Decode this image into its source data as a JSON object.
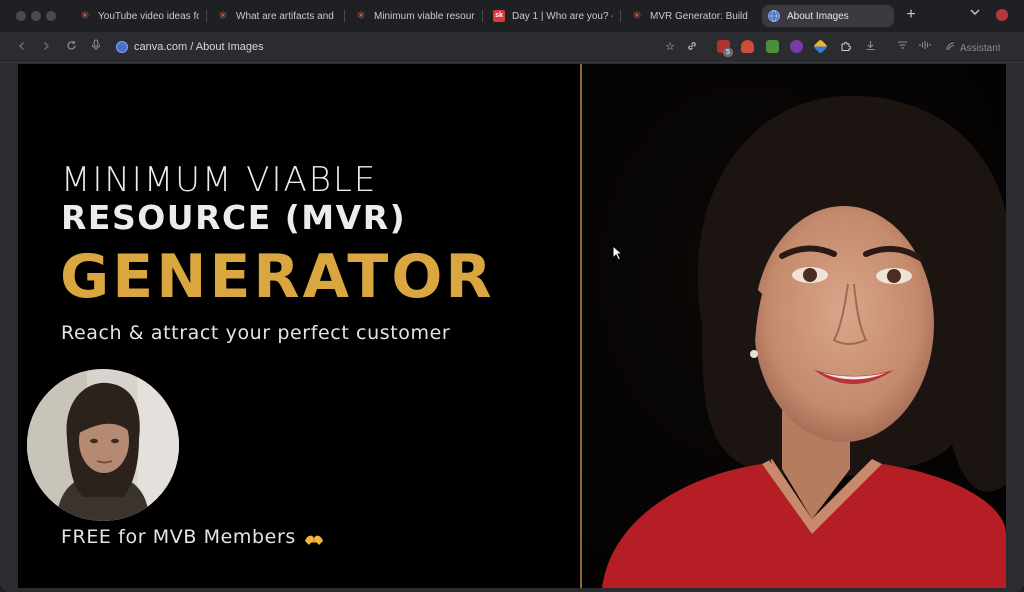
{
  "browser": {
    "tabs": [
      {
        "title": "YouTube video ideas for",
        "icon": "canva-asterisk-icon",
        "active": false
      },
      {
        "title": "What are artifacts and",
        "icon": "canva-asterisk-icon",
        "active": false
      },
      {
        "title": "Minimum viable resourc",
        "icon": "canva-asterisk-icon",
        "active": false
      },
      {
        "title": "Day 1 | Who are you? -",
        "icon": "sk-icon",
        "active": false
      },
      {
        "title": "MVR Generator: Build L",
        "icon": "canva-asterisk-icon",
        "active": false
      },
      {
        "title": "About Images",
        "icon": "globe-icon",
        "active": true
      }
    ],
    "address": "canva.com / About Images",
    "assistant_label": "Assistant",
    "extension_badge": "5",
    "sk_icon_label": "sk"
  },
  "slide": {
    "line1": "MINIMUM VIABLE",
    "line2": "RESOURCE (MVR)",
    "line3": "GENERATOR",
    "tagline": "Reach & attract your perfect customer",
    "footer": "FREE for MVB Members",
    "accent_color": "#d9a640",
    "divider_color": "#8a6b2c"
  }
}
